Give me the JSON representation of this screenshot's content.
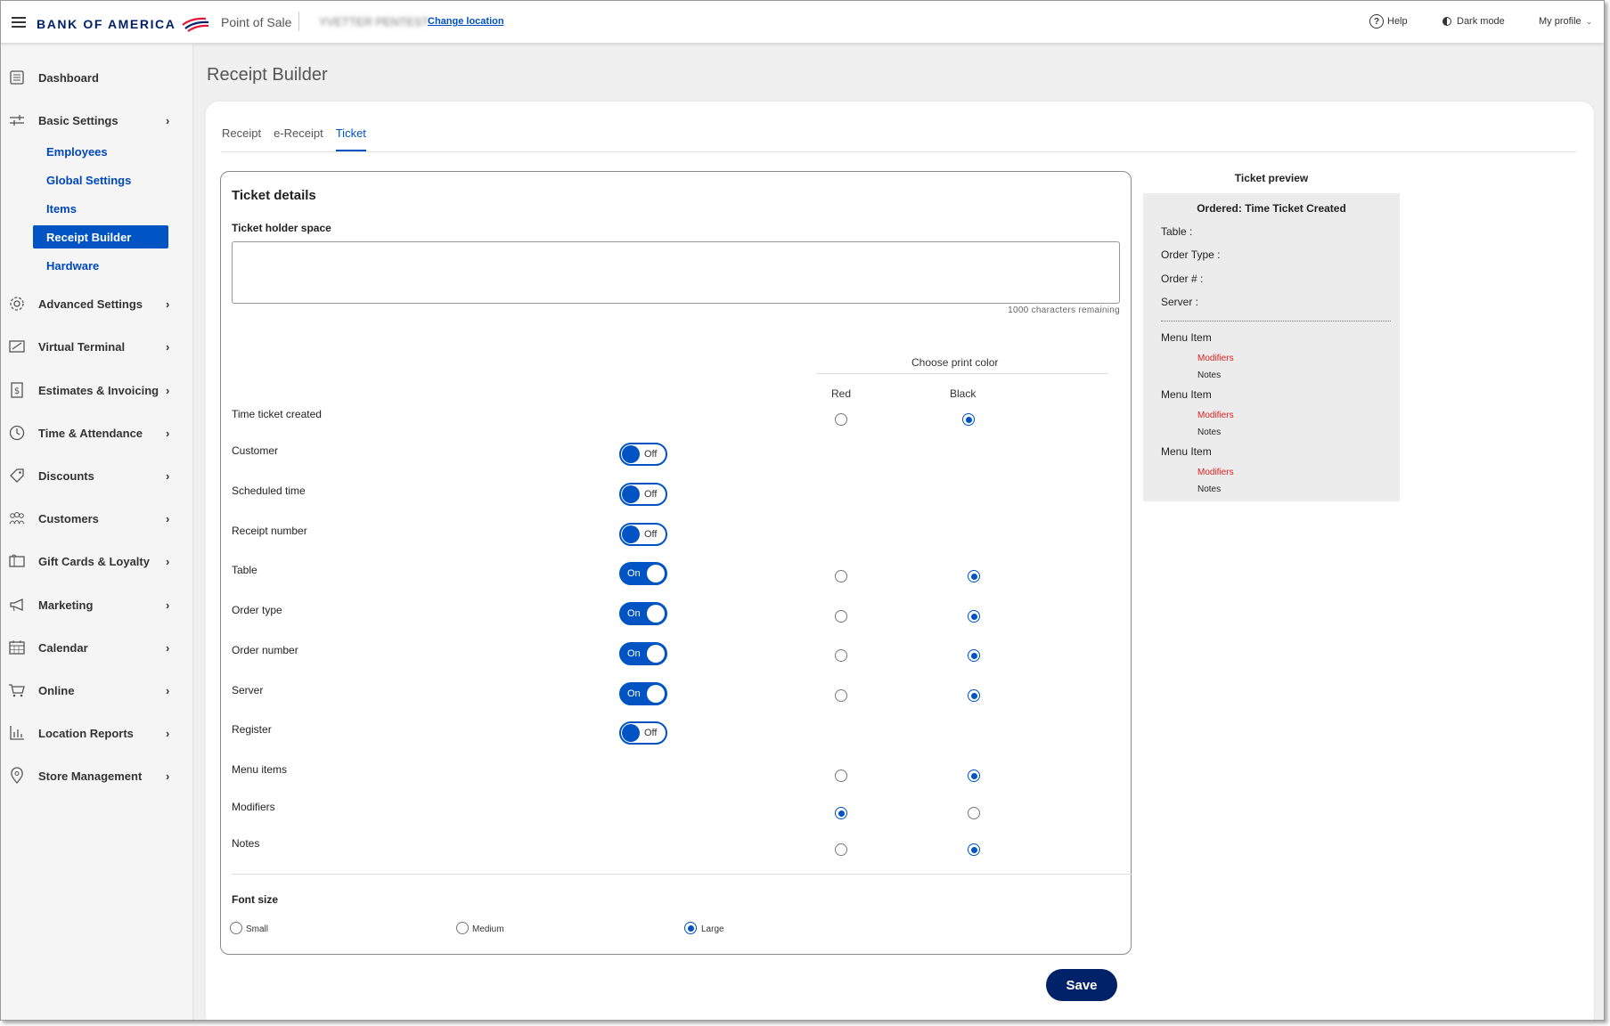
{
  "topbar": {
    "brand": "BANK OF AMERICA",
    "app_name": "Point of Sale",
    "location_name": "YVETTER PENTEST",
    "change_location": "Change location",
    "help": "Help",
    "dark_mode": "Dark mode",
    "profile": "My profile"
  },
  "sidebar": {
    "items": [
      {
        "label": "Dashboard",
        "icon": "dashboard-icon"
      },
      {
        "label": "Basic Settings",
        "icon": "sliders-icon"
      },
      {
        "label": "Advanced Settings",
        "icon": "gear-icon"
      },
      {
        "label": "Virtual Terminal",
        "icon": "terminal-icon"
      },
      {
        "label": "Estimates & Invoicing",
        "icon": "invoice-icon"
      },
      {
        "label": "Time & Attendance",
        "icon": "clock-icon"
      },
      {
        "label": "Discounts",
        "icon": "tag-icon"
      },
      {
        "label": "Customers",
        "icon": "people-icon"
      },
      {
        "label": "Gift Cards & Loyalty",
        "icon": "gift-card-icon"
      },
      {
        "label": "Marketing",
        "icon": "megaphone-icon"
      },
      {
        "label": "Calendar",
        "icon": "calendar-icon"
      },
      {
        "label": "Online",
        "icon": "cart-icon"
      },
      {
        "label": "Location Reports",
        "icon": "bar-chart-icon"
      },
      {
        "label": "Store Management",
        "icon": "pin-icon"
      }
    ],
    "sub_items": [
      "Employees",
      "Global Settings",
      "Items",
      "Receipt Builder",
      "Hardware"
    ],
    "active_sub_item": "Receipt Builder"
  },
  "page": {
    "title": "Receipt Builder",
    "tabs": [
      "Receipt",
      "e-Receipt",
      "Ticket"
    ],
    "active_tab": "Ticket",
    "save_label": "Save"
  },
  "ticket_details": {
    "title": "Ticket details",
    "holder_label": "Ticket holder space",
    "holder_value": "",
    "chars_remaining": "1000 characters remaining",
    "print_color_title": "Choose print color",
    "color_columns": [
      "Red",
      "Black"
    ],
    "rows": [
      {
        "label": "Time ticket created",
        "toggle": null,
        "color": "Black"
      },
      {
        "label": "Customer",
        "toggle": "Off",
        "color": null
      },
      {
        "label": "Scheduled time",
        "toggle": "Off",
        "color": null
      },
      {
        "label": "Receipt number",
        "toggle": "Off",
        "color": null
      },
      {
        "label": "Table",
        "toggle": "On",
        "color": "Black"
      },
      {
        "label": "Order type",
        "toggle": "On",
        "color": "Black"
      },
      {
        "label": "Order number",
        "toggle": "On",
        "color": "Black"
      },
      {
        "label": "Server",
        "toggle": "On",
        "color": "Black"
      },
      {
        "label": "Register",
        "toggle": "Off",
        "color": null
      },
      {
        "label": "Menu items",
        "toggle": null,
        "color": "Black"
      },
      {
        "label": "Modifiers",
        "toggle": null,
        "color": "Red"
      },
      {
        "label": "Notes",
        "toggle": null,
        "color": "Black"
      }
    ],
    "font_size_label": "Font size",
    "font_sizes": [
      "Small",
      "Medium",
      "Large"
    ],
    "font_size_selected": "Large"
  },
  "preview": {
    "title": "Ticket preview",
    "header": "Ordered: Time Ticket Created",
    "fields": [
      "Table :",
      "Order Type :",
      "Order # :",
      "Server :"
    ],
    "menu_item": "Menu Item",
    "modifiers": "Modifiers",
    "notes": "Notes"
  },
  "colors": {
    "brand_navy": "#012169",
    "accent_blue": "#0053c2",
    "modifier_red": "#e31c1c"
  }
}
